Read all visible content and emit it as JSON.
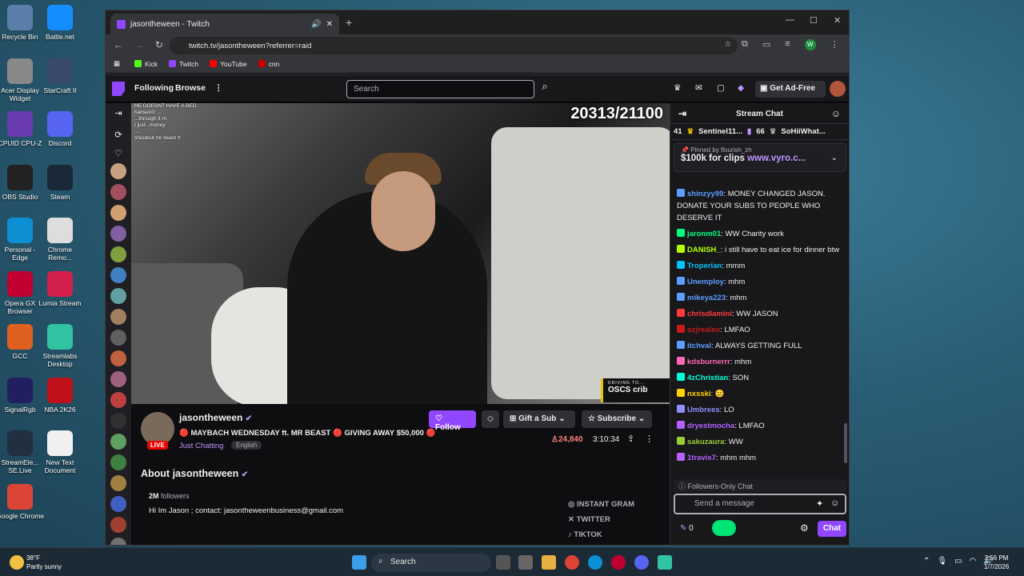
{
  "desktop": {
    "icons": [
      {
        "label": "Recycle Bin",
        "icon": "recycle-bin-icon",
        "color": "#5b7fa8"
      },
      {
        "label": "Battle.net",
        "icon": "battlenet-icon",
        "color": "#148eff"
      },
      {
        "label": "Acer Display Widget",
        "icon": "acer-icon",
        "color": "#888888"
      },
      {
        "label": "StarCraft II",
        "icon": "starcraft-icon",
        "color": "#3a4a6a"
      },
      {
        "label": "CPUID CPU-Z",
        "icon": "cpuz-icon",
        "color": "#6a3ab0"
      },
      {
        "label": "Discord",
        "icon": "discord-icon",
        "color": "#5865f2"
      },
      {
        "label": "OBS Studio",
        "icon": "obs-icon",
        "color": "#222222"
      },
      {
        "label": "Steam",
        "icon": "steam-icon",
        "color": "#1b2838"
      },
      {
        "label": "Personal - Edge",
        "icon": "edge-icon",
        "color": "#0c8fd3"
      },
      {
        "label": "Chrome Remo...",
        "icon": "chrome-remote-icon",
        "color": "#dddddd"
      },
      {
        "label": "Opera GX Browser",
        "icon": "opera-icon",
        "color": "#c2002f"
      },
      {
        "label": "Lumia Stream",
        "icon": "lumia-icon",
        "color": "#d4214c"
      },
      {
        "label": "GCC",
        "icon": "gcc-icon",
        "color": "#e06020"
      },
      {
        "label": "Streamlabs Desktop",
        "icon": "streamlabs-icon",
        "color": "#31c3a2"
      },
      {
        "label": "SignalRgb",
        "icon": "signalrgb-icon",
        "color": "#202060"
      },
      {
        "label": "NBA 2K26",
        "icon": "nba-icon",
        "color": "#c0101a"
      },
      {
        "label": "StreamEle... SE.Live",
        "icon": "streamelements-icon",
        "color": "#203040"
      },
      {
        "label": "New Text Document",
        "icon": "text-doc-icon",
        "color": "#f0f0f0"
      },
      {
        "label": "Google Chrome",
        "icon": "chrome-icon",
        "color": "#db4437"
      }
    ]
  },
  "browser": {
    "tab_title": "jasontheween - Twitch",
    "url": "twitch.tv/jasontheween?referrer=raid",
    "profile_letter": "W",
    "bookmarks": [
      {
        "label": "Kick",
        "color": "#53fc18"
      },
      {
        "label": "Twitch",
        "color": "#9146ff"
      },
      {
        "label": "YouTube",
        "color": "#ff0000"
      },
      {
        "label": "cnn",
        "color": "#cc0000"
      }
    ]
  },
  "twitch": {
    "nav": {
      "following": "Following",
      "browse": "Browse",
      "search_placeholder": "Search",
      "ad_free": "Get Ad-Free"
    },
    "video": {
      "counter": "20313/21100",
      "driving_small": "DRIVING TO...",
      "driving_big": "OSCS crib",
      "overlay_chat": [
        "HE DOESNT HAVE A BED",
        "hansen0: ...",
        "...through it rn",
        "I just...money",
        "...",
        "shoutout mr beast fr"
      ]
    },
    "channel": {
      "name": "jasontheween",
      "live": "LIVE",
      "title": "🔴 MAYBACH WEDNESDAY ft. MR BEAST 🔴 GIVING AWAY $50,000 🔴",
      "category": "Just Chatting",
      "language": "English",
      "viewers": "24,840",
      "uptime": "3:10:34",
      "follow": "Follow",
      "gift": "Gift a Sub",
      "subscribe": "Subscribe",
      "about": "About jasontheween",
      "followers_count": "2M",
      "followers_label": "followers",
      "bio": "Hi Im Jason ; contact: jasontheweenbusiness@gmail.com",
      "socials": [
        "INSTANT GRAM",
        "TWITTER",
        "TIKTOK"
      ]
    },
    "chat": {
      "header": "Stream Chat",
      "leaderboard": [
        {
          "rank": "41",
          "name": ""
        },
        {
          "rank": "",
          "name": "Sentinel11..."
        },
        {
          "rank": "66",
          "name": "SoHiiWhat..."
        }
      ],
      "pinned_by": "Pinned by",
      "pinned_user": "flourish_zh",
      "pinned_text": "$100k for clips",
      "pinned_link": "www.vyro.c...",
      "messages": [
        {
          "user": "shinzyy99",
          "color": "#5c9dff",
          "text": "MONEY CHANGED JASON. DONATE YOUR SUBS TO PEOPLE WHO DESERVE IT"
        },
        {
          "user": "jaronm01",
          "color": "#00ff7f",
          "text": "WW Charity work"
        },
        {
          "user": "DANISH_",
          "color": "#b4ff00",
          "text": "i still have to eat ice for dinner btw"
        },
        {
          "user": "Troperian",
          "color": "#00c2ff",
          "text": "mmm"
        },
        {
          "user": "Unemploy",
          "color": "#5c9dff",
          "text": "mhm"
        },
        {
          "user": "mikeya223",
          "color": "#5c9dff",
          "text": "mhm"
        },
        {
          "user": "chrisdlamini",
          "color": "#ff3c3c",
          "text": "WW JASON"
        },
        {
          "user": "ozjrealeo",
          "color": "#c81a1a",
          "text": "LMFAO"
        },
        {
          "user": "itchval",
          "color": "#5c9dff",
          "text": "ALWAYS GETTING FULL"
        },
        {
          "user": "kdsburnerrr",
          "color": "#ff69b4",
          "text": "mhm"
        },
        {
          "user": "4zChristian",
          "color": "#00ffdd",
          "text": "SON"
        },
        {
          "user": "nxsski",
          "color": "#ffd400",
          "text": "😊"
        },
        {
          "user": "Umbrees",
          "color": "#8f8fff",
          "text": "LO"
        },
        {
          "user": "dryestmocha",
          "color": "#b362ff",
          "text": "LMFAO"
        },
        {
          "user": "sakuzaura",
          "color": "#9acd32",
          "text": "WW"
        },
        {
          "user": "1travis7",
          "color": "#b362ff",
          "text": "mhm mhm"
        }
      ],
      "followers_only": "Followers-Only Chat",
      "input_placeholder": "Send a message",
      "points": "0",
      "chat_button": "Chat"
    }
  },
  "taskbar": {
    "search": "Search",
    "weather_temp": "38°F",
    "weather_desc": "Partly sunny",
    "time": "3:56 PM",
    "date": "1/7/2026"
  }
}
